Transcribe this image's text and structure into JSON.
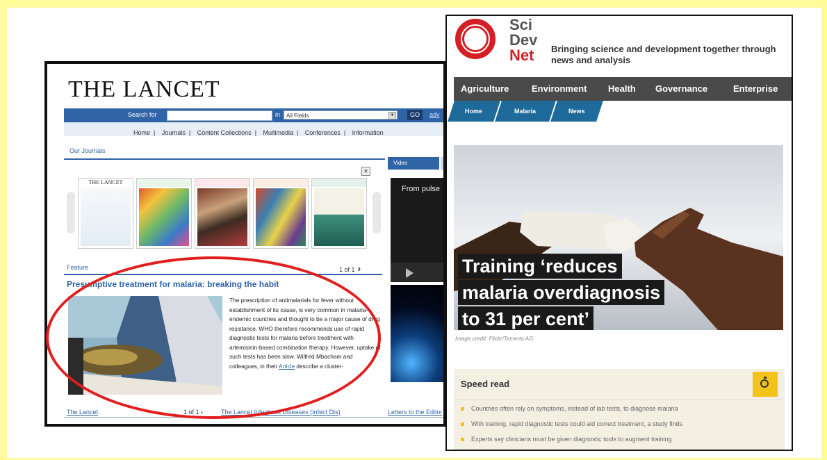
{
  "lancet": {
    "logo": "THE LANCET",
    "search": {
      "label": "Search for",
      "in_label": "in",
      "field_select": "All Fields",
      "go": "GO",
      "advanced": "adv"
    },
    "nav": [
      "Home",
      "Journals",
      "Content Collections",
      "Multimedia",
      "Conferences",
      "Information"
    ],
    "our_journals": "Our Journals",
    "covers": [
      "THE LANCET",
      "",
      "",
      "",
      ""
    ],
    "feature_label": "Feature",
    "pager": "1 of 1",
    "headline": "Presumptive treatment for malaria: breaking the habit",
    "body": "The prescription of antimalarials for fever without establishment of its cause, is very common in malaria-endemic countries and thought to be a major cause of drug resistance. WHO therefore recommends use of rapid diagnostic tests for malaria before treatment with artemisinin-based combination therapy. However, uptake of such tests has been slow. Wilfred Mbacham and colleagues, in their",
    "body_link": "Article",
    "body_tail": "describe a cluster-",
    "footer": {
      "left": "The Lancet",
      "pager": "1 of 1",
      "middle": "The Lancet Infectious Diseases (Infect Dis)",
      "right": "Letters to the Editor"
    },
    "video_tab": "Video",
    "video_title": "From pulse"
  },
  "scidev": {
    "logo": {
      "line1": "Sci",
      "line2": "Dev",
      "line3": "Net"
    },
    "tagline": "Bringing science and development together through news and analysis",
    "nav": [
      "Agriculture",
      "Environment",
      "Health",
      "Governance",
      "Enterprise"
    ],
    "breadcrumbs": [
      "Home",
      "Malaria",
      "News"
    ],
    "headline_lines": [
      "Training ‘reduces",
      "malaria overdiagnosis",
      "to 31 per cent’"
    ],
    "image_credit": "Image credit: Flickr/Temerto AG",
    "speed_read": {
      "title": "Speed read",
      "bullets": [
        "Countries often rely on symptoms, instead of lab tests, to diagnose malaria",
        "With training, rapid diagnostic tests could aid correct treatment, a study finds",
        "Experts say clinicians must be given diagnostic tools to augment training"
      ]
    }
  },
  "colors": {
    "background": "#fffb9a",
    "lancet_blue": "#2f64a6",
    "scidev_red": "#d51f26",
    "highlight_oval": "#e21d1d",
    "speed_read_yellow": "#f2c318"
  }
}
